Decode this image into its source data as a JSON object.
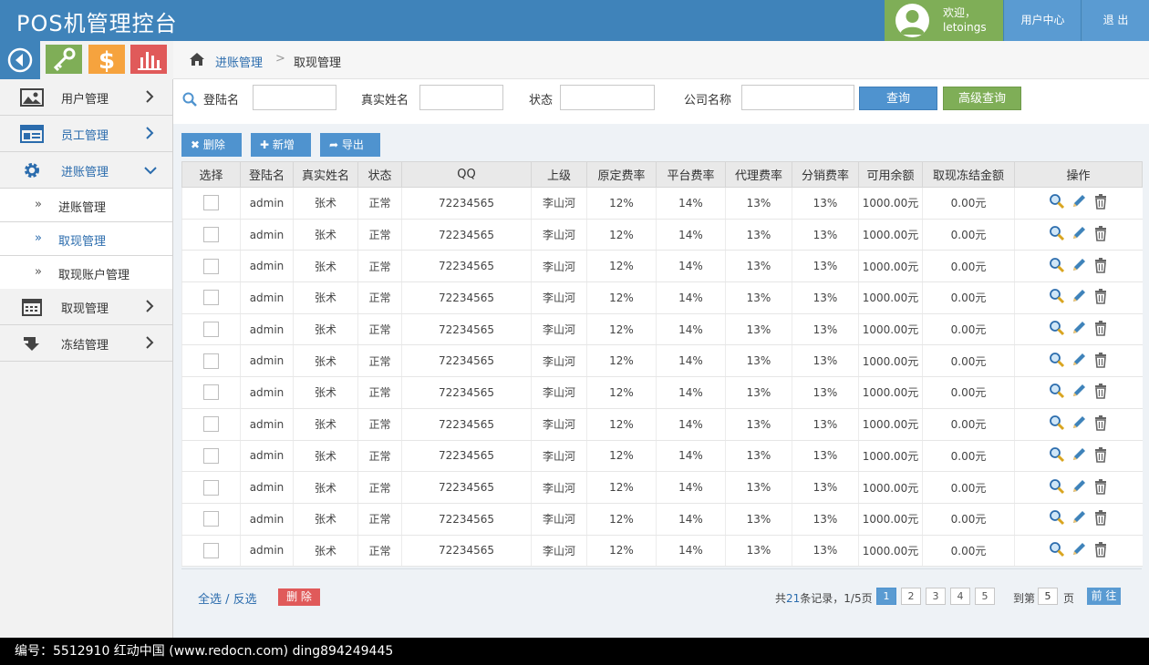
{
  "header": {
    "title": "POS机管理控台",
    "welcome": "欢迎，",
    "username": "letoings",
    "user_center": "用户中心",
    "logout": "退 出",
    "colors": {
      "bar": "#3f83ba",
      "user": "#7fae57"
    }
  },
  "toolbar": {
    "icons": [
      "back-icon",
      "key-icon",
      "dollar-icon",
      "bar-chart-icon"
    ]
  },
  "sidebar": {
    "items": [
      {
        "label": "用户管理",
        "icon": "image-icon"
      },
      {
        "label": "员工管理",
        "icon": "card-icon"
      },
      {
        "label": "进账管理",
        "icon": "gear-icon"
      },
      {
        "label": "取现管理",
        "icon": "calendar-icon"
      },
      {
        "label": "冻结管理",
        "icon": "down-arrow-icon"
      }
    ],
    "subitems": [
      {
        "mark": "»",
        "label": "进账管理"
      },
      {
        "mark": "»",
        "label": "取现管理"
      },
      {
        "mark": "»",
        "label": "取现账户管理"
      }
    ]
  },
  "breadcrumb": {
    "level1": "进账管理",
    "separator": ">",
    "level2": "取现管理"
  },
  "search": {
    "login_label": "登陆名",
    "realname_label": "真实姓名",
    "status_label": "状态",
    "company_label": "公司名称",
    "query_button": "查询",
    "advanced_button": "高级查询"
  },
  "actions": {
    "delete": "删除",
    "add": "新增",
    "export": "导出"
  },
  "table": {
    "headers": [
      "选择",
      "登陆名",
      "真实姓名",
      "状态",
      "QQ",
      "上级",
      "原定费率",
      "平台费率",
      "代理费率",
      "分销费率",
      "可用余额",
      "取现冻结金额",
      "操作"
    ],
    "rows": [
      [
        "admin",
        "张术",
        "正常",
        "72234565",
        "李山河",
        "12%",
        "14%",
        "13%",
        "13%",
        "1000.00元",
        "0.00元"
      ],
      [
        "admin",
        "张术",
        "正常",
        "72234565",
        "李山河",
        "12%",
        "14%",
        "13%",
        "13%",
        "1000.00元",
        "0.00元"
      ],
      [
        "admin",
        "张术",
        "正常",
        "72234565",
        "李山河",
        "12%",
        "14%",
        "13%",
        "13%",
        "1000.00元",
        "0.00元"
      ],
      [
        "admin",
        "张术",
        "正常",
        "72234565",
        "李山河",
        "12%",
        "14%",
        "13%",
        "13%",
        "1000.00元",
        "0.00元"
      ],
      [
        "admin",
        "张术",
        "正常",
        "72234565",
        "李山河",
        "12%",
        "14%",
        "13%",
        "13%",
        "1000.00元",
        "0.00元"
      ],
      [
        "admin",
        "张术",
        "正常",
        "72234565",
        "李山河",
        "12%",
        "14%",
        "13%",
        "13%",
        "1000.00元",
        "0.00元"
      ],
      [
        "admin",
        "张术",
        "正常",
        "72234565",
        "李山河",
        "12%",
        "14%",
        "13%",
        "13%",
        "1000.00元",
        "0.00元"
      ],
      [
        "admin",
        "张术",
        "正常",
        "72234565",
        "李山河",
        "12%",
        "14%",
        "13%",
        "13%",
        "1000.00元",
        "0.00元"
      ],
      [
        "admin",
        "张术",
        "正常",
        "72234565",
        "李山河",
        "12%",
        "14%",
        "13%",
        "13%",
        "1000.00元",
        "0.00元"
      ],
      [
        "admin",
        "张术",
        "正常",
        "72234565",
        "李山河",
        "12%",
        "14%",
        "13%",
        "13%",
        "1000.00元",
        "0.00元"
      ],
      [
        "admin",
        "张术",
        "正常",
        "72234565",
        "李山河",
        "12%",
        "14%",
        "13%",
        "13%",
        "1000.00元",
        "0.00元"
      ],
      [
        "admin",
        "张术",
        "正常",
        "72234565",
        "李山河",
        "12%",
        "14%",
        "13%",
        "13%",
        "1000.00元",
        "0.00元"
      ]
    ],
    "row_action_icons": [
      "search-icon",
      "edit-icon",
      "trash-icon"
    ]
  },
  "footer": {
    "select_all": "全选 / 反选",
    "delete": "删 除",
    "record_prefix": "共",
    "record_count": "21",
    "record_suffix": "条记录，1/5页",
    "pages": [
      "1",
      "2",
      "3",
      "4",
      "5"
    ],
    "current_page": "1",
    "goto_label": "到第",
    "goto_value": "5",
    "page_unit": "页",
    "go_button": "前 往"
  },
  "watermark": "编号：5512910    红动中国 (www.redocn.com)    ding894249445"
}
